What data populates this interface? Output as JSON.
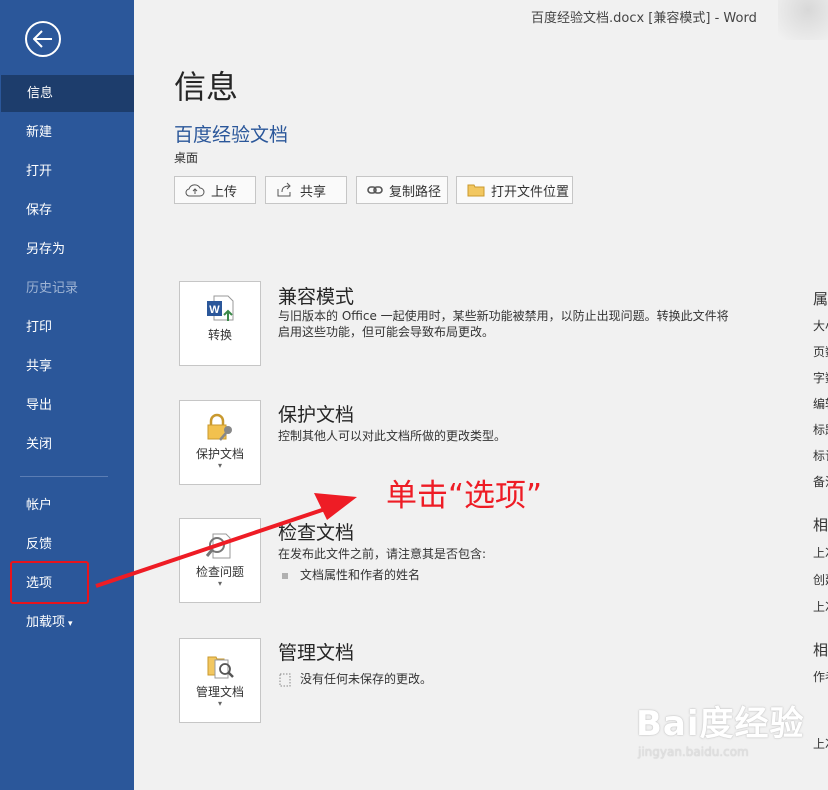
{
  "window": {
    "title": "百度经验文档.docx [兼容模式]  -  Word"
  },
  "sidebar": {
    "items": [
      {
        "label": "信息"
      },
      {
        "label": "新建"
      },
      {
        "label": "打开"
      },
      {
        "label": "保存"
      },
      {
        "label": "另存为"
      },
      {
        "label": "历史记录"
      },
      {
        "label": "打印"
      },
      {
        "label": "共享"
      },
      {
        "label": "导出"
      },
      {
        "label": "关闭"
      },
      {
        "label": "帐户"
      },
      {
        "label": "反馈"
      },
      {
        "label": "选项"
      },
      {
        "label": "加载项"
      }
    ]
  },
  "main": {
    "page_title": "信息",
    "doc_title": "百度经验文档",
    "doc_path": "桌面",
    "actions": [
      {
        "label": "上传"
      },
      {
        "label": "共享"
      },
      {
        "label": "复制路径"
      },
      {
        "label": "打开文件位置"
      }
    ],
    "sections": [
      {
        "button": "转换",
        "title": "兼容模式",
        "desc": "与旧版本的 Office 一起使用时，某些新功能被禁用，以防止出现问题。转换此文件将启用这些功能，但可能会导致布局更改。"
      },
      {
        "button": "保护文档",
        "title": "保护文档",
        "desc": "控制其他人可以对此文档所做的更改类型。"
      },
      {
        "button": "检查问题",
        "title": "检查文档",
        "desc": "在发布此文件之前，请注意其是否包含:",
        "bullet": "文档属性和作者的姓名"
      },
      {
        "button": "管理文档",
        "title": "管理文档",
        "desc": "没有任何未保存的更改。"
      }
    ]
  },
  "properties": {
    "items": [
      "属",
      "大小",
      "页数",
      "字数",
      "编辑",
      "标题",
      "标记",
      "备注",
      "相",
      "上次",
      "创建",
      "上次",
      "相",
      "作者",
      "上次"
    ]
  },
  "annotation": {
    "text": "单击“选项”",
    "color": "#ee1c25"
  },
  "watermark": {
    "main": "Bai度经验",
    "sub": "jingyan.baidu.com"
  },
  "colors": {
    "sidebar": "#2b579a",
    "active": "#1d3d6c",
    "accent": "#2b579a"
  }
}
